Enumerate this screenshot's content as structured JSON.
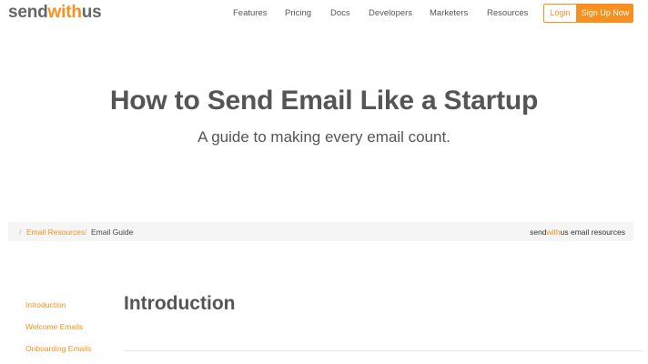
{
  "header": {
    "logo": {
      "part1": "send",
      "part2": "with",
      "part3": "us"
    },
    "nav": [
      "Features",
      "Pricing",
      "Docs",
      "Developers",
      "Marketers",
      "Resources"
    ],
    "login_label": "Login",
    "signup_label": "Sign Up Now"
  },
  "hero": {
    "title": "How to Send Email Like a Startup",
    "subtitle": "A guide to making every email count."
  },
  "breadcrumb": {
    "separator": "/",
    "link": "Email Resources",
    "current": "Email Guide",
    "brand": {
      "part1": "send",
      "part2": "with",
      "part3": "us email resources"
    }
  },
  "sidebar": {
    "items": [
      "Introduction",
      "Welcome Emails",
      "Onboarding Emails"
    ]
  },
  "main": {
    "section_title": "Introduction"
  },
  "colors": {
    "accent": "#F7901E",
    "text": "#555555",
    "crumb_bg": "#f5f5f5"
  }
}
